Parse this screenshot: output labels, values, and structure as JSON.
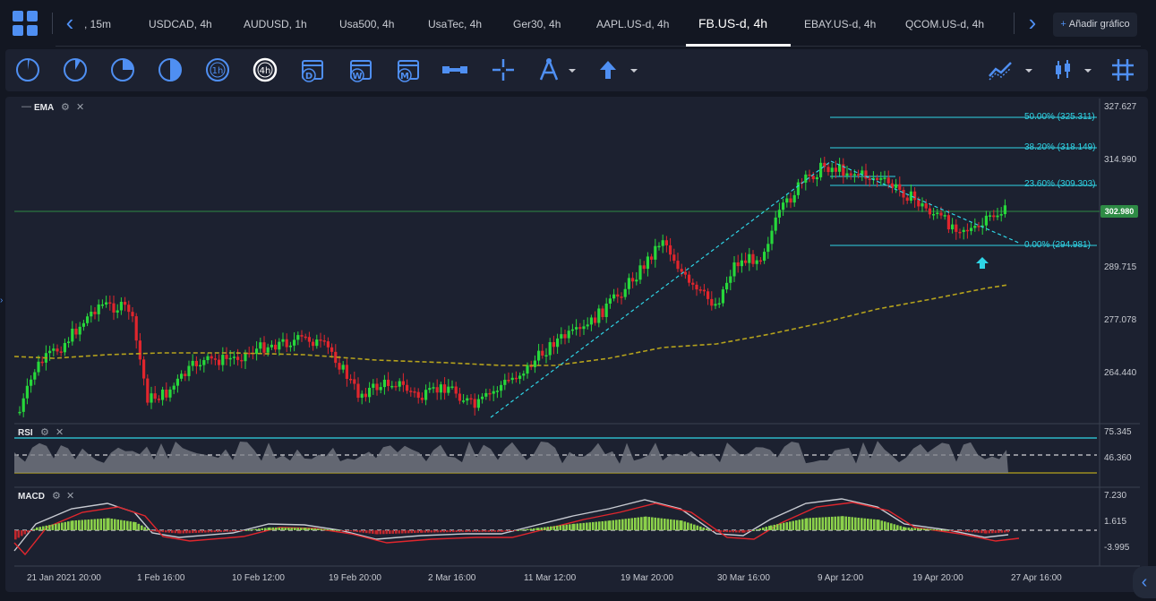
{
  "tabs": [
    {
      "label": ", 15m"
    },
    {
      "label": "USDCAD, 4h"
    },
    {
      "label": "AUDUSD, 1h"
    },
    {
      "label": "Usa500, 4h"
    },
    {
      "label": "UsaTec, 4h"
    },
    {
      "label": "Ger30, 4h"
    },
    {
      "label": "AAPL.US-d, 4h"
    },
    {
      "label": "FB.US-d, 4h"
    },
    {
      "label": "EBAY.US-d, 4h"
    },
    {
      "label": "QCOM.US-d, 4h"
    }
  ],
  "add_chart_label": "Añadir gráfico",
  "timeframe_tools": [
    {
      "icon": "1m-clock-icon"
    },
    {
      "icon": "5m-clock-icon"
    },
    {
      "icon": "15m-clock-icon"
    },
    {
      "icon": "30m-clock-icon"
    },
    {
      "label": "1h"
    },
    {
      "label": "4h"
    },
    {
      "label": "D"
    },
    {
      "label": "W"
    },
    {
      "label": "M"
    }
  ],
  "indicators": {
    "ema": "EMA",
    "rsi": "RSI",
    "macd": "MACD"
  },
  "price_axis": [
    "327.627",
    "314.990",
    "302.980",
    "289.715",
    "277.078",
    "264.440"
  ],
  "current_price": "302.980",
  "fib_levels": [
    {
      "label": "50.00% (325.311)"
    },
    {
      "label": "38.20% (318.149)"
    },
    {
      "label": "23.60% (309.303)"
    },
    {
      "label": "0.00% (294.981)"
    }
  ],
  "rsi_axis": [
    "75.345",
    "46.360"
  ],
  "macd_axis": [
    "7.230",
    "1.615",
    "-3.995"
  ],
  "time_axis": [
    "21 Jan 2021 20:00",
    "1 Feb 16:00",
    "10 Feb 12:00",
    "19 Feb 20:00",
    "2 Mar 16:00",
    "11 Mar 12:00",
    "19 Mar 20:00",
    "30 Mar 16:00",
    "9 Apr 12:00",
    "19 Apr 20:00",
    "27 Apr 16:00"
  ],
  "colors": {
    "up": "#27d83b",
    "down": "#e0262d",
    "accent": "#4f8ff2",
    "fib": "#2fd5e6",
    "ema": "#b5a21c"
  }
}
